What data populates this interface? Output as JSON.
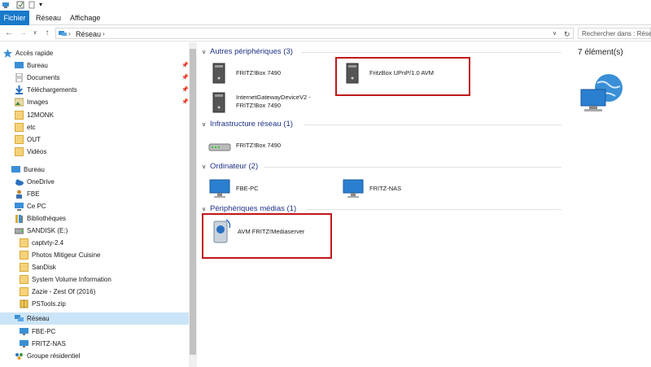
{
  "ribbon": {
    "tabs": [
      {
        "label": "Fichier",
        "active": true
      },
      {
        "label": "Réseau",
        "active": false
      },
      {
        "label": "Affichage",
        "active": false
      }
    ]
  },
  "address": {
    "path": "Réseau",
    "search_placeholder": "Rechercher dans : Réseau"
  },
  "sidebar": {
    "items": [
      {
        "label": "Accès rapide",
        "icon": "star-icon"
      },
      {
        "label": "Bureau",
        "icon": "desktop-icon",
        "pinned": true
      },
      {
        "label": "Documents",
        "icon": "documents-icon",
        "pinned": true
      },
      {
        "label": "Téléchargements",
        "icon": "download-icon",
        "pinned": true
      },
      {
        "label": "Images",
        "icon": "images-icon",
        "pinned": true
      },
      {
        "label": "12MONK",
        "icon": "folder-icon"
      },
      {
        "label": "etc",
        "icon": "folder-icon"
      },
      {
        "label": "OUT",
        "icon": "folder-icon"
      },
      {
        "label": "Vidéos",
        "icon": "folder-icon"
      },
      {
        "label": "Bureau",
        "icon": "desktop-icon"
      },
      {
        "label": "OneDrive",
        "icon": "cloud-icon"
      },
      {
        "label": "FBE",
        "icon": "user-icon"
      },
      {
        "label": "Ce PC",
        "icon": "computer-icon"
      },
      {
        "label": "Bibliothèques",
        "icon": "library-icon"
      },
      {
        "label": "SANDISK (E:)",
        "icon": "drive-icon"
      },
      {
        "label": "captvty-2.4",
        "icon": "folder-icon"
      },
      {
        "label": "Photos Mitigeur Cuisine",
        "icon": "folder-icon"
      },
      {
        "label": "SanDisk",
        "icon": "folder-icon"
      },
      {
        "label": "System Volume Information",
        "icon": "folder-icon"
      },
      {
        "label": "Zazie - Zest Of (2016)",
        "icon": "folder-icon"
      },
      {
        "label": "PSTools.zip",
        "icon": "zip-icon"
      },
      {
        "label": "Réseau",
        "icon": "network-icon",
        "selected": true
      },
      {
        "label": "FBE-PC",
        "icon": "monitor-icon"
      },
      {
        "label": "FRITZ-NAS",
        "icon": "monitor-icon"
      },
      {
        "label": "Groupe résidentiel",
        "icon": "homegroup-icon"
      }
    ]
  },
  "groups": [
    {
      "title": "Autres périphériques (3)",
      "items": [
        "FRITZ!Box 7490",
        "FritzBox UPnP/1.0 AVM",
        "InternetGatewayDeviceV2 -",
        "FRITZ!Box 7490"
      ]
    },
    {
      "title": "Infrastructure réseau (1)",
      "items": [
        "FRITZ!Box 7490"
      ]
    },
    {
      "title": "Ordinateur (2)",
      "items": [
        "FBE-PC",
        "FRITZ-NAS"
      ]
    },
    {
      "title": "Périphériques médias (1)",
      "items": [
        "AVM FRITZ!Mediaserver"
      ]
    }
  ],
  "details": {
    "count": "7 élément(s)"
  },
  "colors": {
    "accent": "#1979ca",
    "highlight": "#c0181b",
    "selected": "#cce4f7"
  }
}
